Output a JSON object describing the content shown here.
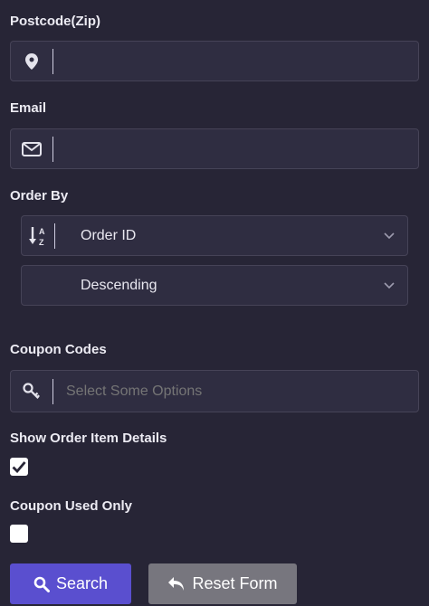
{
  "postcode": {
    "label": "Postcode(Zip)",
    "value": "",
    "icon": "map-marker-icon"
  },
  "email": {
    "label": "Email",
    "value": "",
    "icon": "envelope-icon"
  },
  "order_by": {
    "label": "Order By",
    "icon": "sort-alpha-icon",
    "field_value": "Order ID",
    "direction_value": "Descending"
  },
  "coupon_codes": {
    "label": "Coupon Codes",
    "placeholder": "Select Some Options",
    "icon": "key-icon"
  },
  "show_item_details": {
    "label": "Show Order Item Details",
    "checked": true
  },
  "coupon_used_only": {
    "label": "Coupon Used Only",
    "checked": false
  },
  "buttons": {
    "search_label": "Search",
    "reset_label": "Reset Form"
  },
  "colors": {
    "background": "#272536",
    "field": "#2f2d41",
    "primary_button": "#5a4fcf",
    "secondary_button": "#77767e"
  }
}
